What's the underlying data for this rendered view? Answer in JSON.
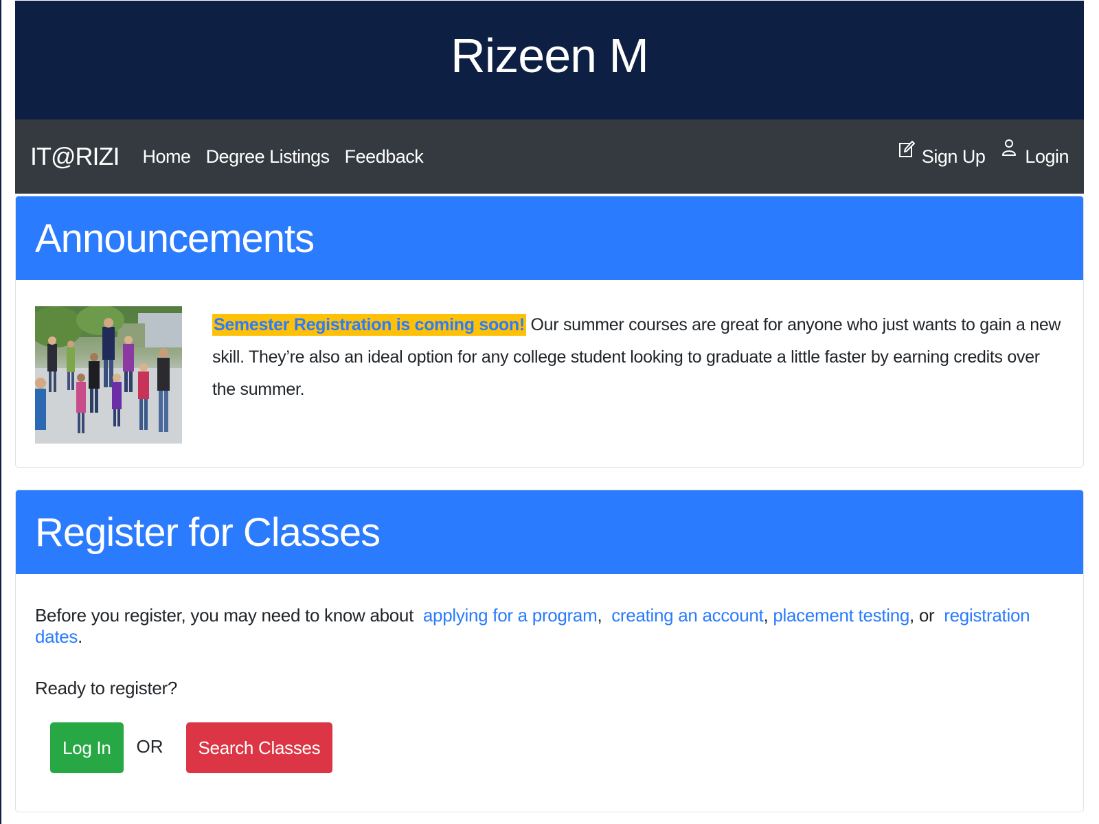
{
  "header": {
    "title": "Rizeen M"
  },
  "navbar": {
    "brand": "IT@RIZI",
    "links": [
      {
        "label": "Home"
      },
      {
        "label": "Degree Listings"
      },
      {
        "label": "Feedback"
      }
    ],
    "right": {
      "signup": {
        "label": "Sign Up",
        "icon": "pencil-square-icon"
      },
      "login": {
        "label": "Login",
        "icon": "user-icon"
      }
    }
  },
  "announcements": {
    "title": "Announcements",
    "highlight": "Semester Registration is coming soon!",
    "text": " Our summer courses are great for anyone who just wants to gain a new skill. They’re also an ideal option for any college student looking to graduate a little faster by earning credits over the summer."
  },
  "register": {
    "title": "Register for Classes",
    "intro": "Before you register, you may need to know about",
    "links": {
      "apply": "applying for a program",
      "account": "creating an account",
      "placement": "placement testing",
      "dates": "registration dates"
    },
    "sep_comma": ",",
    "sep_or": ", or",
    "end_period": ".",
    "ready": "Ready to register?",
    "login_button": "Log In",
    "or": "OR",
    "search_button": "Search Classes"
  },
  "colors": {
    "header_bg": "#0d1f42",
    "navbar_bg": "#343a40",
    "card_header_bg": "#2a7bfd",
    "highlight_bg": "#ffc107",
    "link": "#2a7bfd",
    "btn_green": "#28a745",
    "btn_red": "#dc3545"
  }
}
